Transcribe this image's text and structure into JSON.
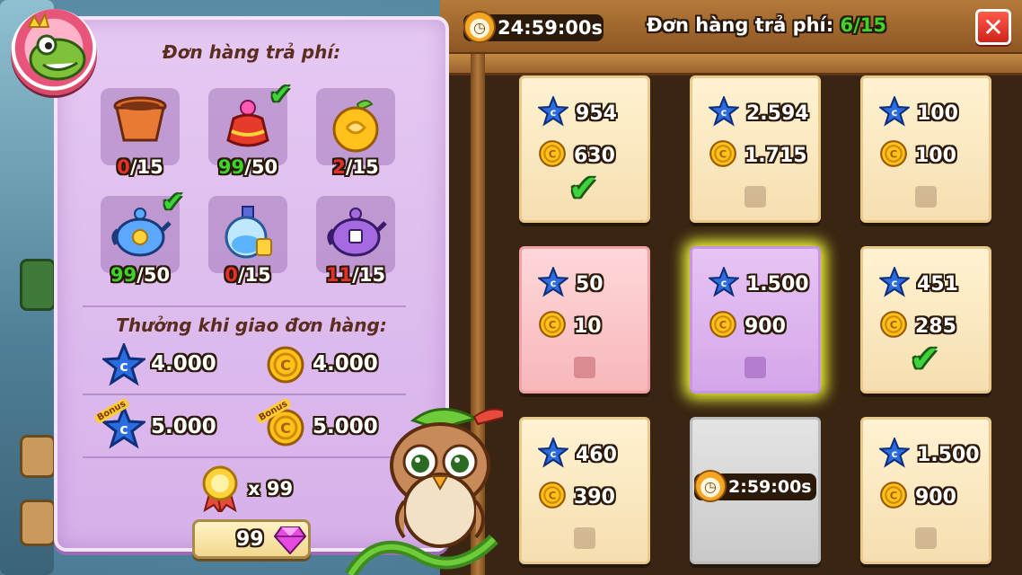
{
  "header": {
    "timer": "24:59:00s",
    "title_prefix": "Đơn hàng trả phí: ",
    "progress": "6/15",
    "close_symbol": "✕"
  },
  "left_panel": {
    "heading": "Đơn hàng trả phí:",
    "items": [
      {
        "name": "clay-pot",
        "have": "0",
        "need": "/15",
        "done": false
      },
      {
        "name": "red-potion",
        "have": "99",
        "need": "/50",
        "done": true
      },
      {
        "name": "golden-fruit",
        "have": "2",
        "need": "/15",
        "done": false
      },
      {
        "name": "blue-teapot",
        "have": "99",
        "need": "/50",
        "done": true
      },
      {
        "name": "glass-bottle",
        "have": "0",
        "need": "/15",
        "done": false
      },
      {
        "name": "purple-teapot",
        "have": "11",
        "need": "/15",
        "done": false
      }
    ],
    "reward_heading": "Thưởng khi giao đơn hàng:",
    "rewards": {
      "star": "4.000",
      "coin": "4.000",
      "bonus_star": "5.000",
      "bonus_coin": "5.000",
      "bonus_label": "Bonus",
      "medal_count": "x 99"
    },
    "cost": "99"
  },
  "orders": [
    {
      "star": "954",
      "coin": "630",
      "state": "done",
      "style": "paper"
    },
    {
      "star": "2.594",
      "coin": "1.715",
      "state": "open",
      "style": "paper"
    },
    {
      "star": "100",
      "coin": "100",
      "state": "open",
      "style": "paper"
    },
    {
      "star": "50",
      "coin": "10",
      "state": "open",
      "style": "pink"
    },
    {
      "star": "1.500",
      "coin": "900",
      "state": "selected",
      "style": "purple"
    },
    {
      "star": "451",
      "coin": "285",
      "state": "done",
      "style": "paper"
    },
    {
      "star": "460",
      "coin": "390",
      "state": "open",
      "style": "paper"
    },
    {
      "timer": "2:59:00s",
      "state": "locked",
      "style": "grey"
    },
    {
      "star": "1.500",
      "coin": "900",
      "state": "open",
      "style": "paper"
    }
  ],
  "colors": {
    "accent_green": "#3dd42a",
    "missing_red": "#e8302a",
    "highlight_yellow": "#f4ff3a"
  }
}
